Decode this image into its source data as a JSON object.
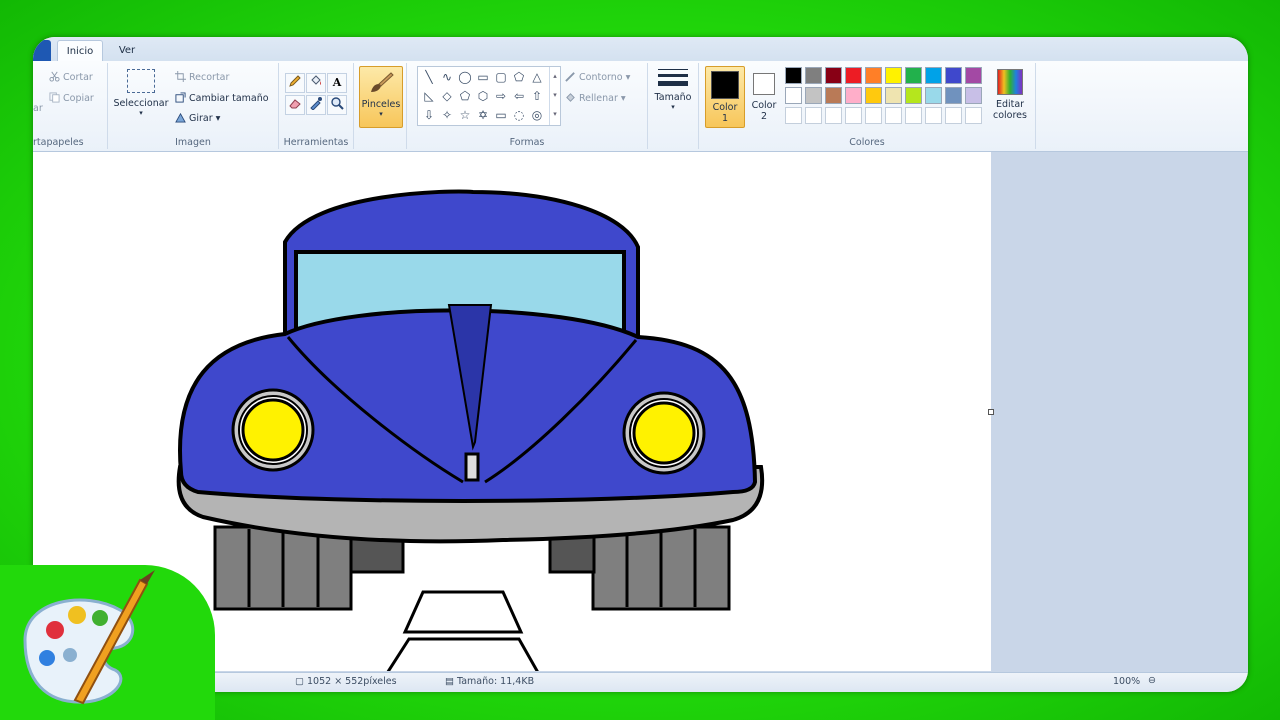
{
  "tabs": [
    {
      "label": "Inicio",
      "active": true
    },
    {
      "label": "Ver",
      "active": false
    }
  ],
  "clipboard": {
    "paste_partial": "ar",
    "cut": "Cortar",
    "copy": "Copiar",
    "group": "rtapapeles"
  },
  "image": {
    "select": "Seleccionar",
    "crop": "Recortar",
    "resize": "Cambiar tamaño",
    "rotate": "Girar",
    "group": "Imagen"
  },
  "tools": {
    "group": "Herramientas",
    "text_icon": "A"
  },
  "brushes": {
    "label": "Pinceles"
  },
  "shapes": {
    "group": "Formas",
    "outline": "Contorno",
    "fill": "Rellenar"
  },
  "size": {
    "label": "Tamaño"
  },
  "colors": {
    "color1_line1": "Color",
    "color1_line2": "1",
    "color2_line1": "Color",
    "color2_line2": "2",
    "edit_line1": "Editar",
    "edit_line2": "colores",
    "group": "Colores",
    "color1": "#000000",
    "color2": "#ffffff",
    "row1": [
      "#000000",
      "#7f7f7f",
      "#880015",
      "#ed1c24",
      "#ff7f27",
      "#fff200",
      "#22b14c",
      "#00a2e8",
      "#3f48cc",
      "#a349a4"
    ],
    "row2": [
      "#ffffff",
      "#c3c3c3",
      "#b97a57",
      "#ffaec9",
      "#ffc90e",
      "#efe4b0",
      "#b5e61d",
      "#99d9ea",
      "#7092be",
      "#c8bfe7"
    ]
  },
  "status": {
    "dimensions": "1052 × 552píxeles",
    "filesize": "Tamaño: 11,4KB",
    "zoom": "100%"
  },
  "drawing": {
    "body_color": "#3f48cc",
    "windshield_color": "#99d9ea",
    "headlight_color": "#fff200",
    "bumper_color": "#b4b4b4",
    "tire_color": "#7f7f7f",
    "stripe_color": "#2b35a8"
  }
}
